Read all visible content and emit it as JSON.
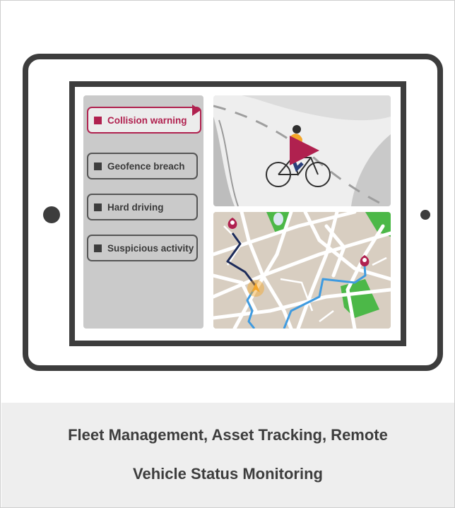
{
  "alerts": [
    {
      "label": "Collision warning",
      "active": true
    },
    {
      "label": "Geofence breach",
      "active": false
    },
    {
      "label": "Hard driving",
      "active": false
    },
    {
      "label": "Suspicious activity",
      "active": false
    }
  ],
  "caption": {
    "line1": "Fleet Management, Asset Tracking, Remote",
    "line2": "Vehicle Status Monitoring"
  },
  "icons": {
    "play": "play-icon",
    "cyclist": "cyclist-illustration",
    "map_pin": "map-pin-icon",
    "vehicle_marker": "vehicle-location-icon"
  },
  "colors": {
    "accent": "#b0214f",
    "device_frame": "#3d3d3d",
    "route_history": "#1c2b5a",
    "route_planned": "#3f9be0",
    "park": "#4cb848",
    "vehicle": "#f4a62a"
  }
}
